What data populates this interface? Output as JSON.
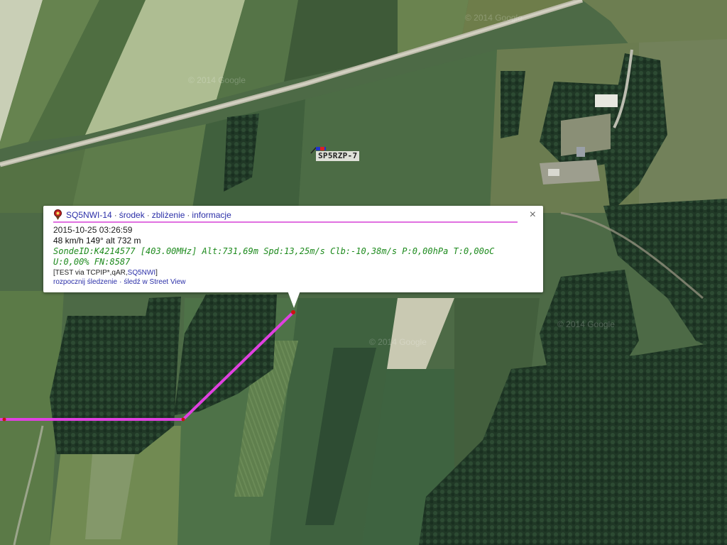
{
  "map": {
    "attribution": "© 2014 Google",
    "track_color": "#e040e0",
    "station": {
      "label": "SP5RZP-7"
    }
  },
  "popup": {
    "callsign": "SQ5NWI-14",
    "links": [
      "środek",
      "zbliżenie",
      "informacje"
    ],
    "timestamp": "2015-10-25 03:26:59",
    "speed_line": "48 km/h 149° alt 732 m",
    "comment": "SondeID:K4214577 [403.00MHz] Alt:731,69m Spd:13,25m/s Clb:-10,38m/s P:0,00hPa T:0,00oC U:0,00% FN:8587",
    "path_prefix": "[TEST via TCPIP*,qAR,",
    "path_link": "SQ5NWI",
    "path_suffix": "]",
    "actions": [
      "rozpocznij śledzenie",
      "śledź w Street View"
    ],
    "close": "×"
  }
}
